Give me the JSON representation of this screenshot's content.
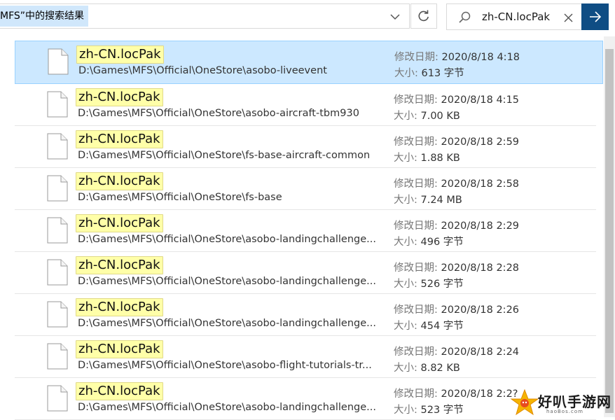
{
  "address_bar": {
    "text": "MFS”中的搜索结果"
  },
  "search": {
    "value": "zh-CN.locPak"
  },
  "labels": {
    "date": "修改日期:",
    "size": "大小:"
  },
  "results": [
    {
      "name": "zh-CN.locPak",
      "path": "D:\\Games\\MFS\\Official\\OneStore\\asobo-liveevent",
      "date": "2020/8/18 4:18",
      "size": "613 字节",
      "selected": true
    },
    {
      "name": "zh-CN.locPak",
      "path": "D:\\Games\\MFS\\Official\\OneStore\\asobo-aircraft-tbm930",
      "date": "2020/8/18 4:15",
      "size": "7.00 KB",
      "selected": false
    },
    {
      "name": "zh-CN.locPak",
      "path": "D:\\Games\\MFS\\Official\\OneStore\\fs-base-aircraft-common",
      "date": "2020/8/18 2:59",
      "size": "1.88 KB",
      "selected": false
    },
    {
      "name": "zh-CN.locPak",
      "path": "D:\\Games\\MFS\\Official\\OneStore\\fs-base",
      "date": "2020/8/18 2:58",
      "size": "7.24 MB",
      "selected": false
    },
    {
      "name": "zh-CN.locPak",
      "path": "D:\\Games\\MFS\\Official\\OneStore\\asobo-landingchallenge...",
      "date": "2020/8/18 2:29",
      "size": "496 字节",
      "selected": false
    },
    {
      "name": "zh-CN.locPak",
      "path": "D:\\Games\\MFS\\Official\\OneStore\\asobo-landingchallenge...",
      "date": "2020/8/18 2:28",
      "size": "526 字节",
      "selected": false
    },
    {
      "name": "zh-CN.locPak",
      "path": "D:\\Games\\MFS\\Official\\OneStore\\asobo-landingchallenge...",
      "date": "2020/8/18 2:26",
      "size": "454 字节",
      "selected": false
    },
    {
      "name": "zh-CN.locPak",
      "path": "D:\\Games\\MFS\\Official\\OneStore\\asobo-flight-tutorials-tr...",
      "date": "2020/8/18 2:24",
      "size": "8.82 KB",
      "selected": false
    },
    {
      "name": "zh-CN.locPak",
      "path": "D:\\Games\\MFS\\Official\\OneStore\\asobo-landingchallenge...",
      "date": "2020/8/18 2:2?",
      "size": "523 字节",
      "selected": false
    }
  ],
  "watermark": {
    "text": "好叭手游网",
    "sub": "haoBos.com"
  },
  "colors": {
    "selected_bg": "#cce8ff",
    "selected_border": "#99d1ff",
    "highlight": "#ffffa8",
    "go_button": "#0f4d84"
  }
}
